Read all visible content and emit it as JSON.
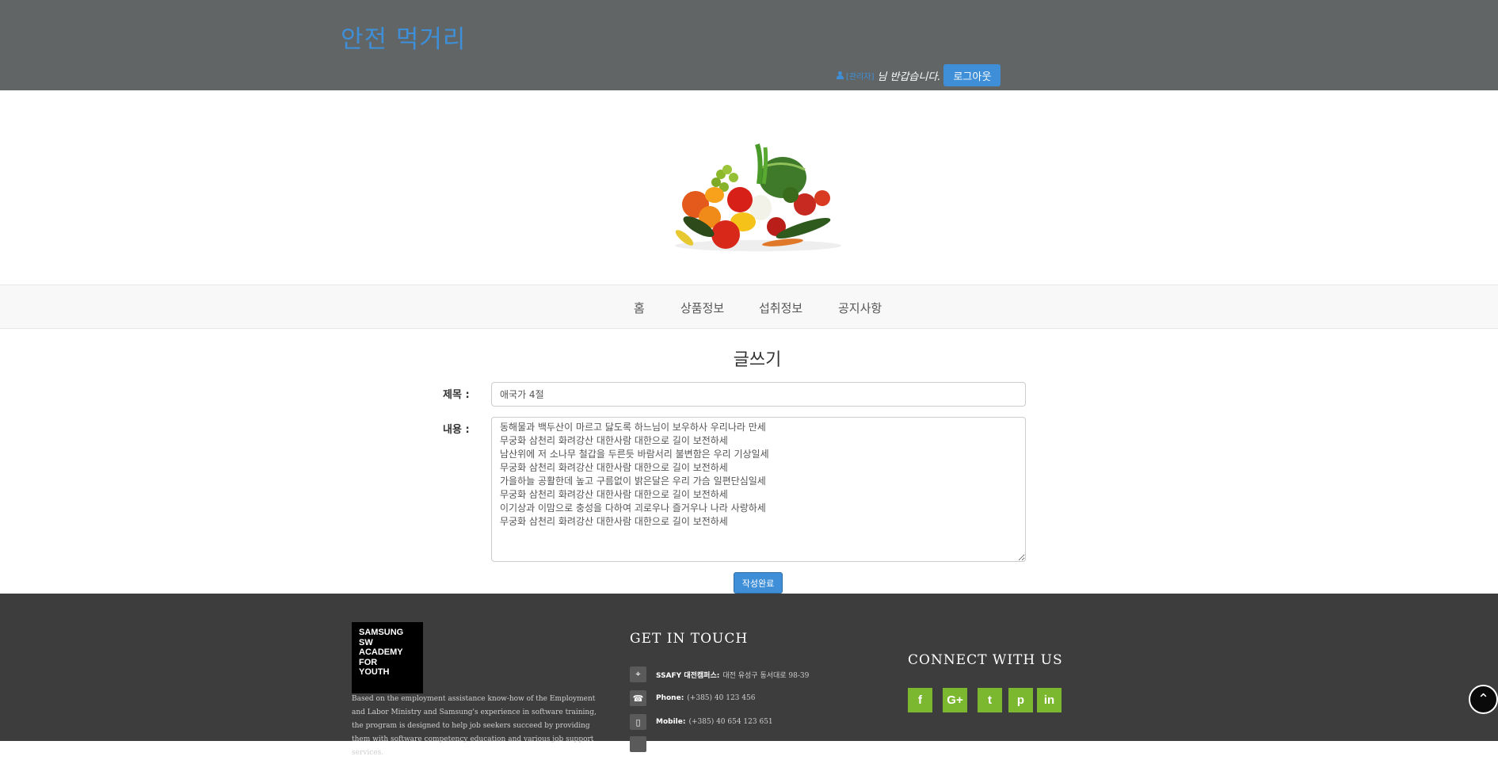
{
  "header": {
    "brand": "안전 먹거리",
    "user_name": "[관리자]",
    "greeting": "님 반갑습니다.",
    "logout_label": "로그아웃"
  },
  "nav": {
    "items": [
      {
        "label": "홈"
      },
      {
        "label": "상품정보"
      },
      {
        "label": "섭취정보"
      },
      {
        "label": "공지사항"
      }
    ]
  },
  "form": {
    "heading": "글쓰기",
    "title_label": "제목 :",
    "title_value": "애국가 4절",
    "content_label": "내용 :",
    "content_value": "동해물과 백두산이 마르고 닳도록 하느님이 보우하사 우리나라 만세\n무궁화 삼천리 화려강산 대한사람 대한으로 길이 보전하세\n남산위에 저 소나무 철갑을 두른듯 바람서리 불변함은 우리 기상일세\n무궁화 삼천리 화려강산 대한사람 대한으로 길이 보전하세\n가을하늘 공활한데 높고 구름없이 밝은달은 우리 가슴 일편단심일세\n무궁화 삼천리 화려강산 대한사람 대한으로 길이 보전하세\n이기상과 이맘으로 충성을 다하여 괴로우나 즐거우나 나라 사랑하세\n무궁화 삼천리 화려강산 대한사람 대한으로 길이 보전하세",
    "submit_label": "작성완료"
  },
  "footer": {
    "logo_lines": [
      "SAMSUNG",
      "SW",
      "ACADEMY",
      "FOR",
      "YOUTH"
    ],
    "about": "Based on the employment assistance know-how of the Employment and Labor Ministry and Samsung's experience in software training, the program is designed to help job seekers succeed by providing them with software competency education and various job support services.",
    "get_in_touch": "GET IN TOUCH",
    "contacts": [
      {
        "icon": "map-marker-icon",
        "key": "SSAFY 대전캠퍼스:",
        "value": "대전 유성구 동서대로 98-39"
      },
      {
        "icon": "phone-icon",
        "key": "Phone:",
        "value": "(+385) 40 123 456"
      },
      {
        "icon": "mobile-icon",
        "key": "Mobile:",
        "value": "(+385) 40 654 123 651"
      }
    ],
    "connect": "CONNECT WITH US",
    "social": [
      {
        "icon": "facebook-icon",
        "glyph": "f"
      },
      {
        "icon": "google-plus-icon",
        "glyph": "G+"
      },
      {
        "icon": "twitter-icon",
        "glyph": "t"
      },
      {
        "icon": "pinterest-icon",
        "glyph": "p"
      },
      {
        "icon": "linkedin-icon",
        "glyph": "in"
      }
    ],
    "to_top_glyph": "⌃"
  },
  "colors": {
    "header_bg": "#626565",
    "accent_blue": "#3e8fd8",
    "footer_bg": "#3d3d3d",
    "social_green": "#7cb82f"
  }
}
